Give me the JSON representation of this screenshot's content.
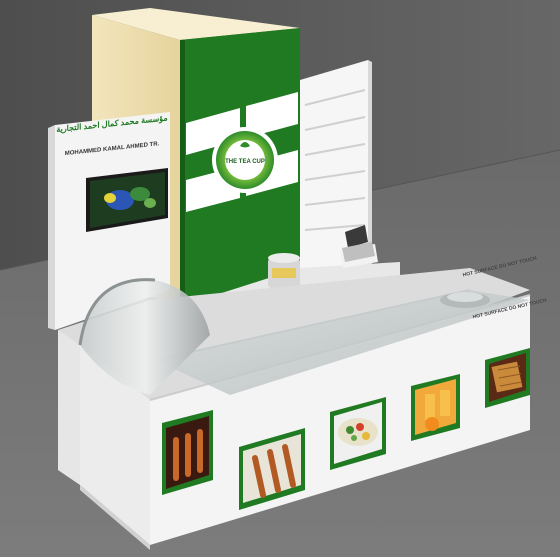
{
  "scene": {
    "subject": "kiosk-render",
    "brand_name": "THE TEA CUP",
    "company_arabic": "مؤسسة محمد كمال احمد التجارية",
    "company_latin": "MOHAMMED KAMAL AHMED TR.",
    "counter_notice_line1": "HOT SURFACE DO NOT TOUCH",
    "counter_notice_line2": "HOT SURFACE DO NOT TOUCH",
    "colors": {
      "brand_green": "#1f7a22",
      "light_green": "#7ec845",
      "kiosk_white": "#f4f4f4",
      "cream_tower": "#f1e2b2",
      "floor_gray": "#727272",
      "wall_gray": "#5c5c5c"
    },
    "panels": [
      {
        "id": "panel-1",
        "depicts": "grilled-skewers"
      },
      {
        "id": "panel-2",
        "depicts": "grilled-skewers"
      },
      {
        "id": "panel-3",
        "depicts": "mixed-salad"
      },
      {
        "id": "panel-4",
        "depicts": "orange-juice"
      },
      {
        "id": "panel-5",
        "depicts": "waffles"
      }
    ]
  }
}
